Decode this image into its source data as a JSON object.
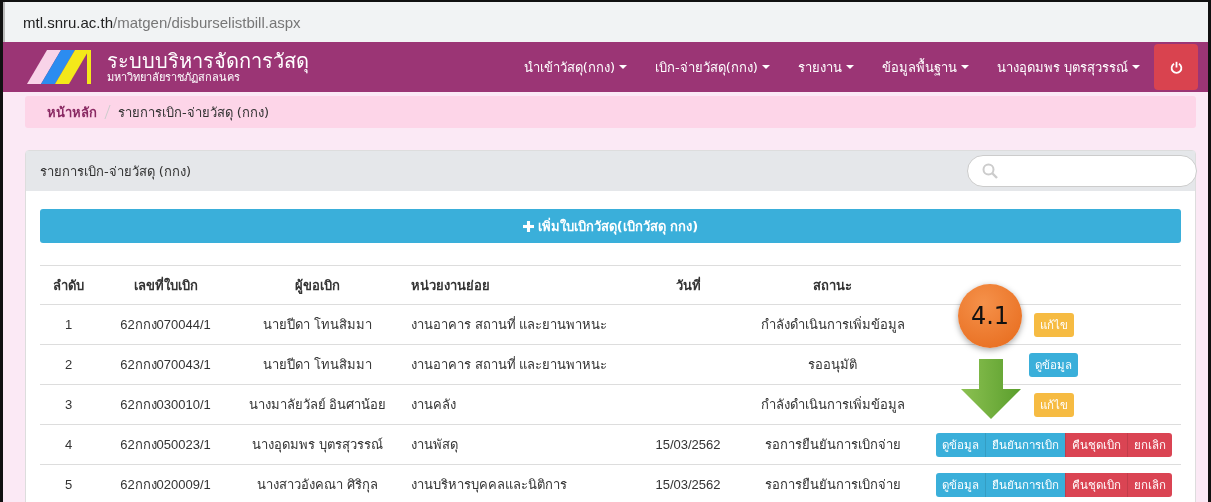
{
  "address_bar": {
    "host": "mtl.snru.ac.th",
    "path": "/matgen/disburselistbill.aspx"
  },
  "navbar": {
    "brand_title": "ระบบบริหารจัดการวัสดุ",
    "brand_subtitle": "มหาวิทยาลัยราชภัฏสกลนคร",
    "menus": [
      {
        "label": "นำเข้าวัสดุ(กกง)"
      },
      {
        "label": "เบิก-จ่ายวัสดุ(กกง) "
      },
      {
        "label": "รายงาน "
      },
      {
        "label": "ข้อมูลพื้นฐาน "
      },
      {
        "label": "นางอุดมพร บุตรสุวรรณ์"
      }
    ]
  },
  "breadcrumb": [
    {
      "label": "หน้าหลัก"
    },
    {
      "label": "รายการเบิก-จ่ายวัสดุ (กกง)"
    }
  ],
  "panel": {
    "title": "รายการเบิก-จ่ายวัสดุ (กกง)",
    "add_button": "เพิ่มใบเบิกวัสดุ(เบิกวัสดุ กกง)",
    "table": {
      "columns": [
        "ลำดับ",
        "เลขที่ใบเบิก",
        "ผู้ขอเบิก",
        "หน่วยงานย่อย",
        "วันที่",
        "สถานะ"
      ],
      "rows": [
        {
          "no": "1",
          "bill": "62กกง070044/1",
          "requester": "นายปีดา โทนสิมมา",
          "unit": "งานอาคาร สถานที่ และยานพาหนะ",
          "status": "กำลังดำเนินการเพิ่มข้อมูล",
          "actions": [
            {
              "label": "แก้ไข",
              "kind": "warning"
            }
          ]
        },
        {
          "no": "2",
          "bill": "62กกง070043/1",
          "requester": "นายปีดา โทนสิมมา",
          "unit": "งานอาคาร สถานที่ และยานพาหนะ",
          "status": "รออนุมัติ",
          "actions": [
            {
              "label": "ดูข้อมูล",
              "kind": "info"
            }
          ]
        },
        {
          "no": "3",
          "bill": "62กกง030010/1",
          "requester": "นางมาลัยวัลย์ อินศาน้อย",
          "unit": "งานคลัง",
          "status": "กำลังดำเนินการเพิ่มข้อมูล",
          "actions": [
            {
              "label": "แก้ไข",
              "kind": "warning"
            }
          ]
        },
        {
          "no": "4",
          "bill": "62กกง050023/1",
          "requester": "นางอุดมพร บุตรสุวรรณ์",
          "unit": "งานพัสดุ",
          "date": "15/03/2562",
          "status": "รอการยืนยันการเบิกจ่าย",
          "actions": [
            {
              "label": "ดูข้อมูล",
              "kind": "info"
            },
            {
              "label": "ยืนยันการเบิก",
              "kind": "info"
            },
            {
              "label": "คืนชุดเบิก",
              "kind": "danger"
            },
            {
              "label": "ยกเลิก",
              "kind": "danger"
            }
          ]
        },
        {
          "no": "5",
          "bill": "62กกง020009/1",
          "requester": "นางสาวอังคณา ศิริกุล",
          "unit": "งานบริหารบุคคลและนิติการ",
          "date": "15/03/2562",
          "status": "รอการยืนยันการเบิกจ่าย",
          "actions": [
            {
              "label": "ดูข้อมูล",
              "kind": "info"
            },
            {
              "label": "ยืนยันการเบิก",
              "kind": "info"
            },
            {
              "label": "คืนชุดเบิก",
              "kind": "danger"
            },
            {
              "label": "ยกเลิก",
              "kind": "danger"
            }
          ]
        }
      ]
    }
  },
  "annotation": {
    "label": "4.1"
  }
}
